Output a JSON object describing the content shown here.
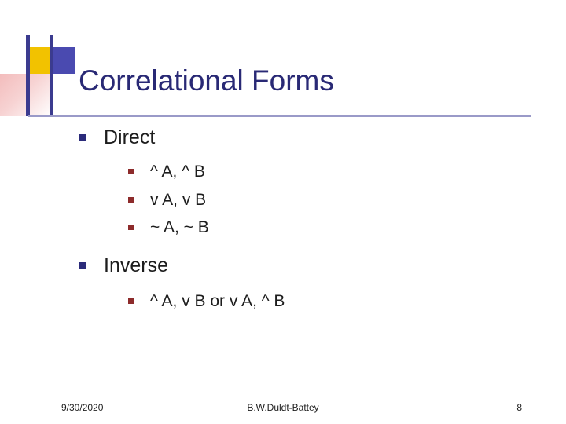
{
  "slide": {
    "title": "Correlational Forms",
    "sections": [
      {
        "heading": "Direct",
        "items": [
          "^ A, ^ B",
          "v A, v B",
          "~ A, ~ B"
        ]
      },
      {
        "heading": "Inverse",
        "items": [
          "^ A, v B or v A, ^ B"
        ]
      }
    ],
    "footer": {
      "date": "9/30/2020",
      "author": "B.W.Duldt-Battey",
      "page_number": "8"
    },
    "colors": {
      "title": "#292975",
      "level1_bullet": "#2b2b7a",
      "level2_bullet": "#8d2b2b",
      "rule": "#9a9ac8",
      "deco_yellow": "#f2c200",
      "deco_blue": "#4a4ab0",
      "deco_pink": "#f3bcbc"
    }
  }
}
